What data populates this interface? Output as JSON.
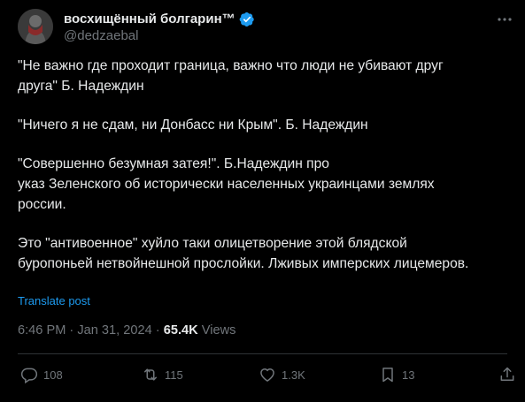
{
  "author": {
    "display_name": "восхищённый болгарин™",
    "handle": "@dedzaebal"
  },
  "post": {
    "paragraphs": [
      "\"Не важно где проходит граница, важно что люди не убивают друг\nдруга\"  Б. Надеждин",
      "\"Ничего я не сдам, ни Донбасс ни Крым\". Б. Надеждин",
      "\"Совершенно безумная затея!\". Б.Надеждин про\nуказ Зеленского об исторически населенных украинцами землях\nроссии.",
      "Это \"антивоенное\" хуйло таки олицетворение этой блядской\nбуропоньей нетвойнешной прослойки. Лживых имперских лицемеров."
    ],
    "translate_label": "Translate post"
  },
  "meta": {
    "time": "6:46 PM",
    "sep1": " · ",
    "date": "Jan 31, 2024",
    "sep2": " · ",
    "views_count": "65.4K",
    "views_label": " Views"
  },
  "actions": {
    "replies": "108",
    "reposts": "115",
    "likes": "1.3K",
    "bookmarks": "13"
  },
  "icons": {
    "verified": "verified-badge-icon",
    "more": "more-dots-icon",
    "reply": "reply-icon",
    "repost": "repost-icon",
    "like": "heart-icon",
    "bookmark": "bookmark-icon",
    "share": "share-icon"
  },
  "colors": {
    "background": "#000000",
    "text": "#e7e9ea",
    "muted": "#71767b",
    "accent": "#1d9bf0",
    "divider": "#2f3336"
  }
}
